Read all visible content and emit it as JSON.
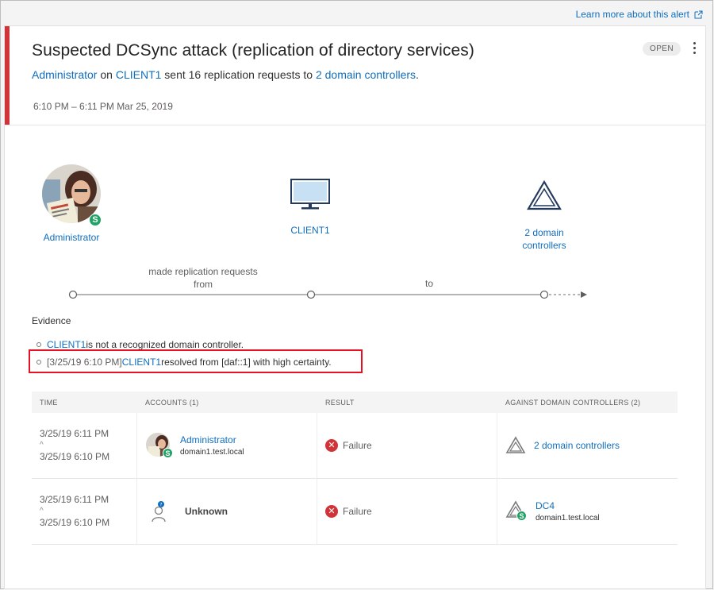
{
  "learn_more": "Learn more about this alert",
  "alert": {
    "title": "Suspected DCSync attack (replication of directory services)",
    "subtitle": {
      "account": "Administrator",
      "on": " on ",
      "host": "CLIENT1",
      "middle": " sent 16 replication requests to ",
      "target": "2 domain controllers",
      "end": "."
    },
    "time_range": "6:10 PM – 6:11 PM",
    "date": "Mar 25, 2019",
    "status": "OPEN",
    "severity_color": "#d13438"
  },
  "diagram": {
    "source": {
      "label": "Administrator",
      "icon": "user-avatar"
    },
    "host": {
      "label": "CLIENT1",
      "icon": "monitor-icon"
    },
    "target": {
      "label_line1": "2 domain",
      "label_line2": "controllers",
      "icon": "domain-controller-icon"
    },
    "edge1_line1": "made replication requests",
    "edge1_line2": "from",
    "edge2": "to"
  },
  "evidence": {
    "title": "Evidence",
    "items": [
      {
        "prefix": "",
        "link": "CLIENT1",
        "text": " is not a recognized domain controller."
      },
      {
        "prefix": "[3/25/19 6:10 PM] ",
        "link": "CLIENT1",
        "text": " resolved from [daf::1] with high certainty."
      }
    ]
  },
  "table": {
    "headers": [
      "TIME",
      "ACCOUNTS (1)",
      "RESULT",
      "AGAINST DOMAIN CONTROLLERS (2)"
    ],
    "rows": [
      {
        "time_end": "3/25/19 6:11 PM",
        "time_start": "3/25/19 6:10 PM",
        "account": "Administrator",
        "account_domain": "domain1.test.local",
        "result": "Failure",
        "dc": "2 domain controllers",
        "dc_domain": ""
      },
      {
        "time_end": "3/25/19 6:11 PM",
        "time_start": "3/25/19 6:10 PM",
        "account": "Unknown",
        "account_domain": "",
        "result": "Failure",
        "dc": "DC4",
        "dc_domain": "domain1.test.local"
      }
    ]
  }
}
